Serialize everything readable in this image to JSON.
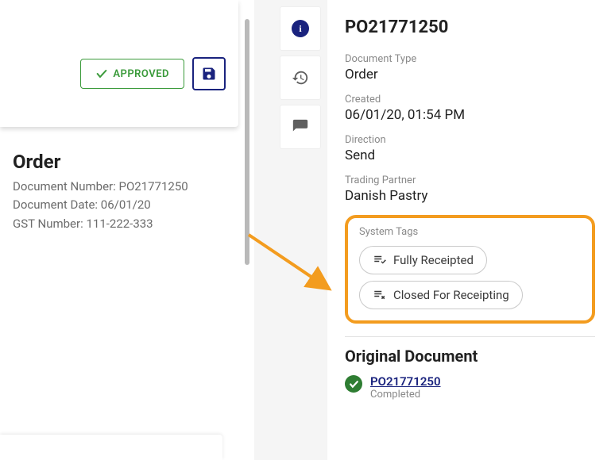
{
  "left": {
    "approved_label": "APPROVED",
    "heading": "Order",
    "doc_number_label": "Document Number: ",
    "doc_number_value": "PO21771250",
    "doc_date_label": "Document Date: ",
    "doc_date_value": "06/01/20",
    "gst_label": "GST Number: ",
    "gst_value": "111-222-333"
  },
  "detail": {
    "title": "PO21771250",
    "fields": {
      "doc_type_label": "Document Type",
      "doc_type_value": "Order",
      "created_label": "Created",
      "created_value": "06/01/20, 01:54 PM",
      "direction_label": "Direction",
      "direction_value": "Send",
      "partner_label": "Trading Partner",
      "partner_value": "Danish Pastry",
      "tags_label": "System Tags"
    },
    "tags": {
      "tag1": "Fully Receipted",
      "tag2": "Closed For Receipting"
    },
    "original": {
      "heading": "Original Document",
      "link": "PO21771250",
      "status": "Completed"
    }
  }
}
